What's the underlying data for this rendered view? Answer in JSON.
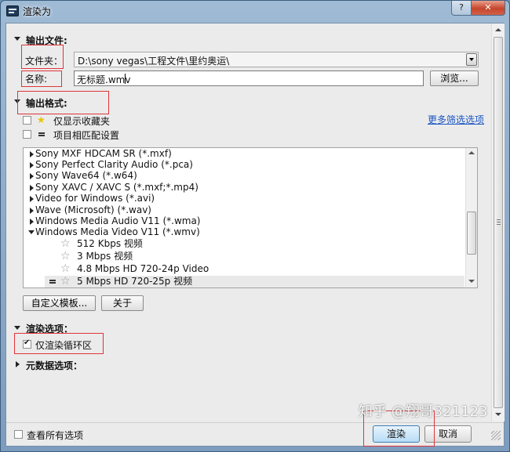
{
  "window": {
    "title": "渲染为",
    "help_label": "?",
    "close_label": "✕"
  },
  "output_file": {
    "section_title": "输出文件:",
    "folder_label": "文件夹：",
    "folder_value": "D:\\sony vegas\\工程文件\\里约奥运\\",
    "name_label": "名称:",
    "name_value": "无标题.wmv",
    "browse_label": "浏览..."
  },
  "output_format": {
    "section_title": "输出格式:",
    "favorites_label": "仅显示收藏夹",
    "favorites_checked": false,
    "match_project_label": "项目相匹配设置",
    "match_project_checked": false,
    "more_filter_link": "更多筛选选项",
    "formats": [
      {
        "label": "Sony MXF HDCAM SR (*.mxf)",
        "expanded": false
      },
      {
        "label": "Sony Perfect Clarity Audio (*.pca)",
        "expanded": false
      },
      {
        "label": "Sony Wave64 (*.w64)",
        "expanded": false
      },
      {
        "label": "Sony XAVC / XAVC S (*.mxf;*.mp4)",
        "expanded": false
      },
      {
        "label": "Video for Windows (*.avi)",
        "expanded": false
      },
      {
        "label": "Wave (Microsoft) (*.wav)",
        "expanded": false
      },
      {
        "label": "Windows Media Audio V11 (*.wma)",
        "expanded": false
      },
      {
        "label": "Windows Media Video V11 (*.wmv)",
        "expanded": true
      }
    ],
    "templates": [
      {
        "label": "512 Kbps 视频",
        "selected": false
      },
      {
        "label": "3 Mbps 视频",
        "selected": false
      },
      {
        "label": "4.8 Mbps HD 720-24p Video",
        "selected": false
      },
      {
        "label": "5 Mbps HD 720-25p 视频",
        "selected": true
      }
    ],
    "customize_label": "自定义模板...",
    "about_label": "关于"
  },
  "render_options": {
    "section_title": "渲染选项：",
    "loop_region_label": "仅渲染循环区",
    "loop_region_checked": true
  },
  "metadata": {
    "section_title": "元数据选项："
  },
  "footer": {
    "show_all_label": "查看所有选项",
    "show_all_checked": false,
    "render_label": "渲染",
    "cancel_label": "取消"
  },
  "watermark": "知乎 @翔哥321123",
  "colors": {
    "highlight_box": "#e0353a",
    "link": "#1a55c2"
  }
}
